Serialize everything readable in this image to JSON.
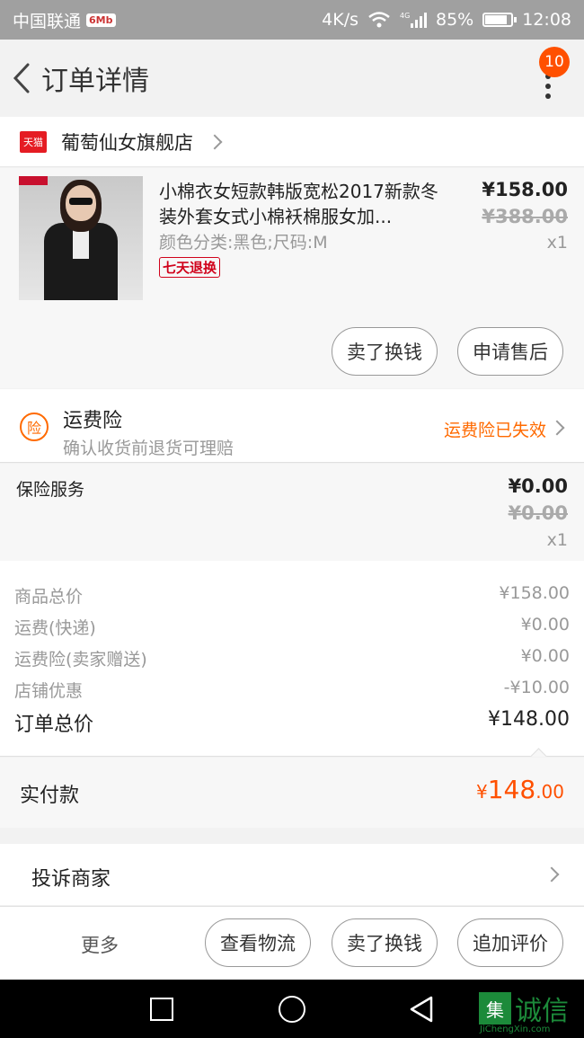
{
  "status_bar": {
    "carrier": "中国联通",
    "carrier_badge": "6Mb",
    "speed": "4K/s",
    "network": "4G",
    "battery": "85%",
    "battery_level": 0.85,
    "time": "12:08"
  },
  "header": {
    "title": "订单详情",
    "badge_count": "10"
  },
  "shop": {
    "logo_text": "天猫",
    "name": "葡萄仙女旗舰店"
  },
  "product": {
    "title": "小棉衣女短款韩版宽松2017新款冬装外套女式小棉袄棉服女加...",
    "spec": "颜色分类:黑色;尺码:M",
    "badge": "七天退换",
    "price": "¥158.00",
    "original_price": "¥388.00",
    "quantity": "x1",
    "buttons": [
      "卖了换钱",
      "申请售后"
    ]
  },
  "insurance": {
    "title": "运费险",
    "icon_text": "险",
    "subtitle": "确认收货前退货可理赔",
    "status": "运费险已失效"
  },
  "service": {
    "name": "保险服务",
    "price": "¥0.00",
    "original_price": "¥0.00",
    "quantity": "x1"
  },
  "summary": {
    "rows": [
      {
        "label": "商品总价",
        "value": "¥158.00"
      },
      {
        "label": "运费(快递)",
        "value": "¥0.00"
      },
      {
        "label": "运费险(卖家赠送)",
        "value": "¥0.00"
      },
      {
        "label": "店铺优惠",
        "value": "-¥10.00"
      }
    ],
    "total_label": "订单总价",
    "total_value": "¥148.00"
  },
  "paid": {
    "label": "实付款",
    "currency": "¥",
    "integer": "148",
    "decimal": ".00"
  },
  "complain": {
    "label": "投诉商家"
  },
  "bottom_bar": {
    "more": "更多",
    "buttons": [
      "查看物流",
      "卖了换钱",
      "追加评价"
    ]
  },
  "watermark": {
    "logo": "集",
    "text": "诚信",
    "sub": "JiChengXin.com"
  },
  "colors": {
    "accent": "#ff5000",
    "insurance": "#ff6a00",
    "tmall": "#e51c23"
  }
}
